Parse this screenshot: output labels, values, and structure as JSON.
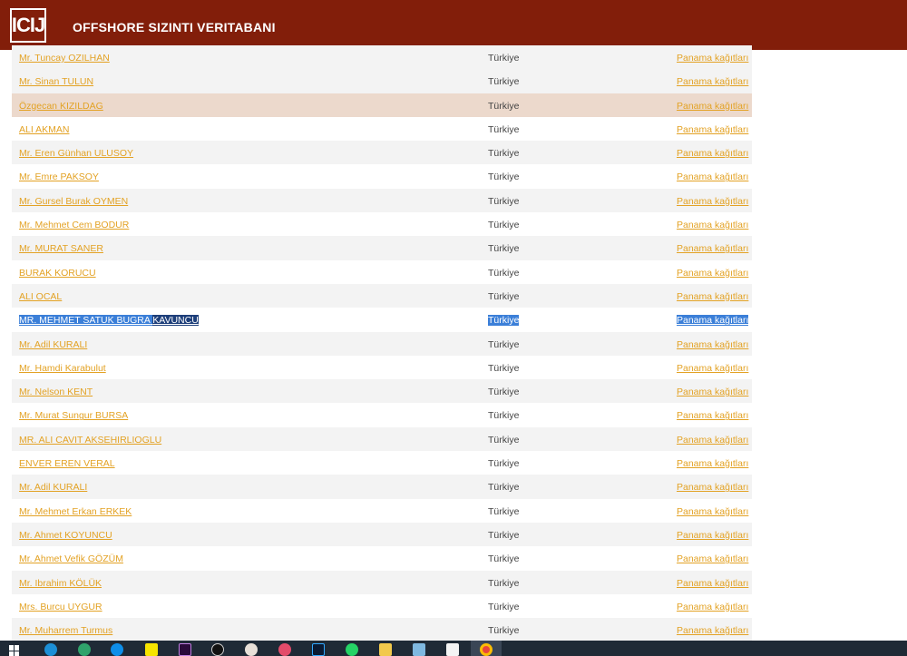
{
  "header": {
    "logo": "ICIJ",
    "title": "OFFSHORE SIZINTI VERITABANI"
  },
  "rows": [
    {
      "name": "Mr. Tuncay OZILHAN",
      "country": "Türkiye",
      "source": "Panama kağıtları"
    },
    {
      "name": "Mr. Sinan TULUN",
      "country": "Türkiye",
      "source": "Panama kağıtları"
    },
    {
      "name": "Özgecan KIZILDAG",
      "country": "Türkiye",
      "source": "Panama kağıtları"
    },
    {
      "name": "ALI AKMAN",
      "country": "Türkiye",
      "source": "Panama kağıtları"
    },
    {
      "name": "Mr. Eren Günhan ULUSOY",
      "country": "Türkiye",
      "source": "Panama kağıtları"
    },
    {
      "name": "Mr. Emre PAKSOY",
      "country": "Türkiye",
      "source": "Panama kağıtları"
    },
    {
      "name": "Mr. Gursel Burak OYMEN",
      "country": "Türkiye",
      "source": "Panama kağıtları"
    },
    {
      "name": "Mr. Mehmet Cem BODUR",
      "country": "Türkiye",
      "source": "Panama kağıtları"
    },
    {
      "name": "Mr. MURAT SANER",
      "country": "Türkiye",
      "source": "Panama kağıtları"
    },
    {
      "name": "BURAK KORUCU",
      "country": "Türkiye",
      "source": "Panama kağıtları"
    },
    {
      "name": "ALI OCAL",
      "country": "Türkiye",
      "source": "Panama kağıtları"
    },
    {
      "name_part1": "MR. MEHMET SATUK BUGRA",
      "name_part2": "KAVUNCU",
      "country": "Türkiye",
      "source": "Panama kağıtları"
    },
    {
      "name": "Mr. Adil KURALI",
      "country": "Türkiye",
      "source": "Panama kağıtları"
    },
    {
      "name": "Mr. Hamdi Karabulut",
      "country": "Türkiye",
      "source": "Panama kağıtları"
    },
    {
      "name": "Mr. Nelson KENT",
      "country": "Türkiye",
      "source": "Panama kağıtları"
    },
    {
      "name": "Mr. Murat Sungur BURSA",
      "country": "Türkiye",
      "source": "Panama kağıtları"
    },
    {
      "name": "MR. ALI CAVIT AKSEHIRLIOGLU",
      "country": "Türkiye",
      "source": "Panama kağıtları"
    },
    {
      "name": "ENVER EREN VERAL",
      "country": "Türkiye",
      "source": "Panama kağıtları"
    },
    {
      "name": "Mr. Adil KURALI",
      "country": "Türkiye",
      "source": "Panama kağıtları"
    },
    {
      "name": "Mr. Mehmet Erkan ERKEK",
      "country": "Türkiye",
      "source": "Panama kağıtları"
    },
    {
      "name": "Mr. Ahmet KOYUNCU",
      "country": "Türkiye",
      "source": "Panama kağıtları"
    },
    {
      "name": "Mr. Ahmet Vefik GÖZÜM",
      "country": "Türkiye",
      "source": "Panama kağıtları"
    },
    {
      "name": "Mr. Ibrahim KÖLÜK",
      "country": "Türkiye",
      "source": "Panama kağıtları"
    },
    {
      "name": "Mrs. Burcu UYGUR",
      "country": "Türkiye",
      "source": "Panama kağıtları"
    },
    {
      "name": "Mr. Muharrem Turmus",
      "country": "Türkiye",
      "source": "Panama kağıtları"
    }
  ],
  "taskbar": {
    "icons": [
      "windows-start-icon",
      "edge-legacy-icon",
      "edge-icon",
      "teamviewer-icon",
      "snapchat-icon",
      "premiere-pro-icon",
      "clock-app-icon",
      "paint-icon",
      "color-wheel-icon",
      "photoshop-icon",
      "whatsapp-icon",
      "file-explorer-icon",
      "notepad-icon",
      "document-icon",
      "chrome-icon"
    ]
  },
  "colors": {
    "header_bg": "#821e0a",
    "link": "#e3a224",
    "row_alt": "#f3f3f3",
    "row_hover": "#ecd9cc",
    "selection": "#3b7fd8",
    "taskbar": "#1f2a36"
  }
}
